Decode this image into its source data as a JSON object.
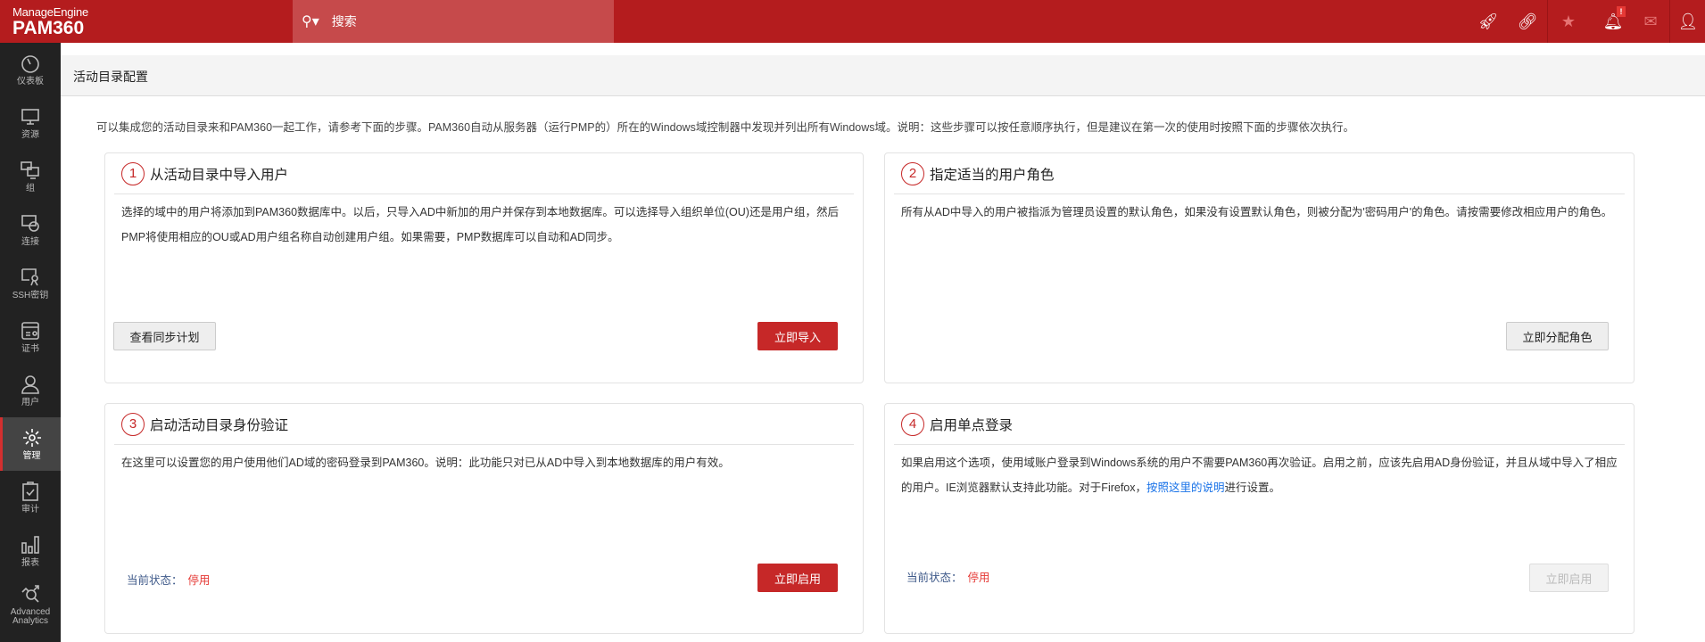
{
  "header": {
    "brand": "ManageEngine",
    "product": "PAM360",
    "search_placeholder": "搜索",
    "notification_badge": "!"
  },
  "sidebar": {
    "items": [
      {
        "label": "仪表板",
        "icon": "dashboard-icon"
      },
      {
        "label": "资源",
        "icon": "monitor-icon"
      },
      {
        "label": "组",
        "icon": "group-icon"
      },
      {
        "label": "连接",
        "icon": "connection-icon"
      },
      {
        "label": "SSH密钥",
        "icon": "key-icon"
      },
      {
        "label": "证书",
        "icon": "certificate-icon"
      },
      {
        "label": "用户",
        "icon": "user-icon"
      },
      {
        "label": "管理",
        "icon": "gear-icon",
        "active": true
      },
      {
        "label": "审计",
        "icon": "clipboard-icon"
      },
      {
        "label": "报表",
        "icon": "bar-chart-icon"
      },
      {
        "label": "Advanced Analytics",
        "icon": "analytics-icon"
      }
    ]
  },
  "page": {
    "title": "活动目录配置",
    "intro": "可以集成您的活动目录来和PAM360一起工作，请参考下面的步骤。PAM360自动从服务器（运行PMP的）所在的Windows域控制器中发现并列出所有Windows域。说明：这些步骤可以按任意顺序执行，但是建议在第一次的使用时按照下面的步骤依次执行。"
  },
  "cards": [
    {
      "num": "1",
      "title": "从活动目录中导入用户",
      "body": "选择的域中的用户将添加到PAM360数据库中。以后，只导入AD中新加的用户并保存到本地数据库。可以选择导入组织单位(OU)还是用户组，然后PMP将使用相应的OU或AD用户组名称自动创建用户组。如果需要，PMP数据库可以自动和AD同步。",
      "secondary_button": "查看同步计划",
      "primary_button": "立即导入"
    },
    {
      "num": "2",
      "title": "指定适当的用户角色",
      "body": "所有从AD中导入的用户被指派为管理员设置的默认角色，如果没有设置默认角色，则被分配为'密码用户'的角色。请按需要修改相应用户的角色。",
      "button": "立即分配角色"
    },
    {
      "num": "3",
      "title": "启动活动目录身份验证",
      "body": "在这里可以设置您的用户使用他们AD域的密码登录到PAM360。说明：此功能只对已从AD中导入到本地数据库的用户有效。",
      "status_label": "当前状态：",
      "status_value": "停用",
      "button": "立即启用"
    },
    {
      "num": "4",
      "title": "启用单点登录",
      "body_before": "如果启用这个选项，使用域账户登录到Windows系统的用户不需要PAM360再次验证。启用之前，应该先启用AD身份验证，并且从域中导入了相应的用户。IE浏览器默认支持此功能。对于Firefox，",
      "link": "按照这里的说明",
      "body_after": "进行设置。",
      "status_label": "当前状态：",
      "status_value": "停用",
      "button": "立即启用"
    }
  ]
}
